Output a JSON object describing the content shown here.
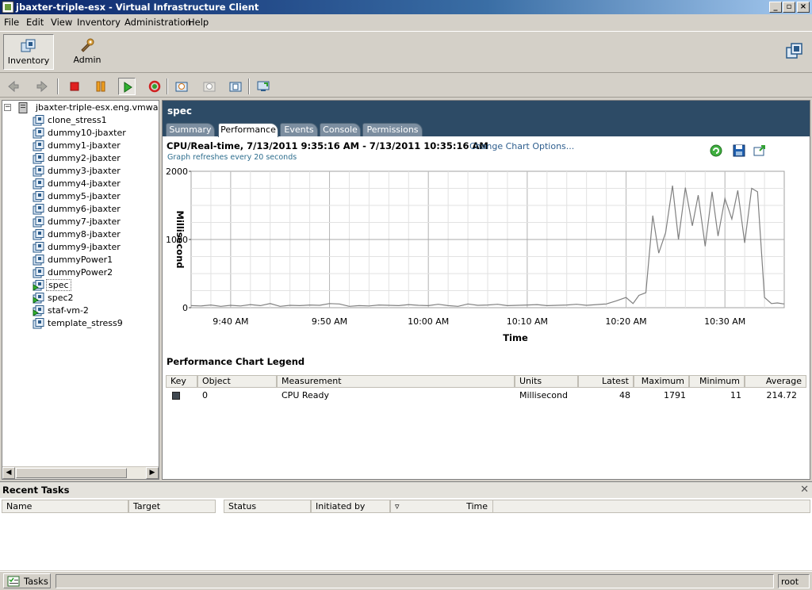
{
  "window": {
    "title": "jbaxter-triple-esx - Virtual Infrastructure Client"
  },
  "menu": [
    "File",
    "Edit",
    "View",
    "Inventory",
    "Administration",
    "Help"
  ],
  "nav_buttons": {
    "inventory": "Inventory",
    "admin": "Admin"
  },
  "tree": {
    "root": "jbaxter-triple-esx.eng.vmware.c",
    "items": [
      {
        "label": "clone_stress1",
        "state": "off"
      },
      {
        "label": "dummy10-jbaxter",
        "state": "off"
      },
      {
        "label": "dummy1-jbaxter",
        "state": "off"
      },
      {
        "label": "dummy2-jbaxter",
        "state": "off"
      },
      {
        "label": "dummy3-jbaxter",
        "state": "off"
      },
      {
        "label": "dummy4-jbaxter",
        "state": "off"
      },
      {
        "label": "dummy5-jbaxter",
        "state": "off"
      },
      {
        "label": "dummy6-jbaxter",
        "state": "off"
      },
      {
        "label": "dummy7-jbaxter",
        "state": "off"
      },
      {
        "label": "dummy8-jbaxter",
        "state": "off"
      },
      {
        "label": "dummy9-jbaxter",
        "state": "off"
      },
      {
        "label": "dummyPower1",
        "state": "off"
      },
      {
        "label": "dummyPower2",
        "state": "off"
      },
      {
        "label": "spec",
        "state": "on",
        "selected": true
      },
      {
        "label": "spec2",
        "state": "on"
      },
      {
        "label": "staf-vm-2",
        "state": "on"
      },
      {
        "label": "template_stress9",
        "state": "off"
      }
    ]
  },
  "vm": {
    "name": "spec",
    "tabs": [
      "Summary",
      "Performance",
      "Events",
      "Console",
      "Permissions"
    ],
    "active_tab": "Performance"
  },
  "chart_header": {
    "title": "CPU/Real-time, 7/13/2011 9:35:16 AM - 7/13/2011 10:35:16 AM",
    "options_link": "Change Chart Options...",
    "refresh_note": "Graph refreshes every 20 seconds"
  },
  "chart_data": {
    "type": "line",
    "xlabel": "Time",
    "ylabel": "Millisecond",
    "x_ticks": [
      "9:40 AM",
      "9:50 AM",
      "10:00 AM",
      "10:10 AM",
      "10:20 AM",
      "10:30 AM"
    ],
    "y_ticks": [
      "0",
      "1000",
      "2000"
    ],
    "ylim": [
      0,
      2000
    ],
    "x_range_minutes": [
      36,
      96
    ],
    "grid": true,
    "series": [
      {
        "color": "#808080",
        "x_minutes": [
          36,
          37,
          38,
          39,
          40,
          41,
          42,
          43,
          44,
          45,
          46,
          47,
          48,
          49,
          50,
          51,
          52,
          53,
          54,
          55,
          56,
          57,
          58,
          59,
          60,
          61,
          62,
          63,
          64,
          65,
          66,
          67,
          68,
          69,
          70,
          71,
          72,
          73,
          74,
          75,
          76,
          77,
          78,
          79,
          80,
          80.7,
          81.3,
          82,
          82.7,
          83.3,
          84,
          84.7,
          85.3,
          86,
          86.7,
          87.3,
          88,
          88.7,
          89.3,
          90,
          90.7,
          91.3,
          92,
          92.7,
          93.3,
          94,
          94.7,
          95.3,
          96
        ],
        "values": [
          30,
          25,
          40,
          20,
          35,
          25,
          45,
          30,
          60,
          20,
          35,
          30,
          40,
          35,
          60,
          55,
          20,
          30,
          25,
          40,
          35,
          30,
          45,
          35,
          30,
          50,
          30,
          20,
          55,
          35,
          40,
          50,
          30,
          35,
          40,
          45,
          30,
          35,
          40,
          50,
          35,
          45,
          55,
          100,
          150,
          60,
          180,
          220,
          1350,
          800,
          1100,
          1790,
          1000,
          1760,
          1200,
          1650,
          900,
          1700,
          1050,
          1600,
          1300,
          1720,
          950,
          1750,
          1700,
          150,
          60,
          70,
          55
        ]
      }
    ]
  },
  "legend": {
    "title": "Performance Chart Legend",
    "columns": [
      "Key",
      "Object",
      "Measurement",
      "Units",
      "Latest",
      "Maximum",
      "Minimum",
      "Average"
    ],
    "rows": [
      {
        "key_color": "#404850",
        "object": "0",
        "measurement": "CPU Ready",
        "units": "Millisecond",
        "latest": "48",
        "maximum": "1791",
        "minimum": "11",
        "average": "214.72"
      }
    ]
  },
  "tasks": {
    "title": "Recent Tasks",
    "columns": [
      "Name",
      "Target",
      "Status",
      "Initiated by",
      "",
      "Time"
    ]
  },
  "status": {
    "tasks_tab": "Tasks",
    "user": "root"
  }
}
